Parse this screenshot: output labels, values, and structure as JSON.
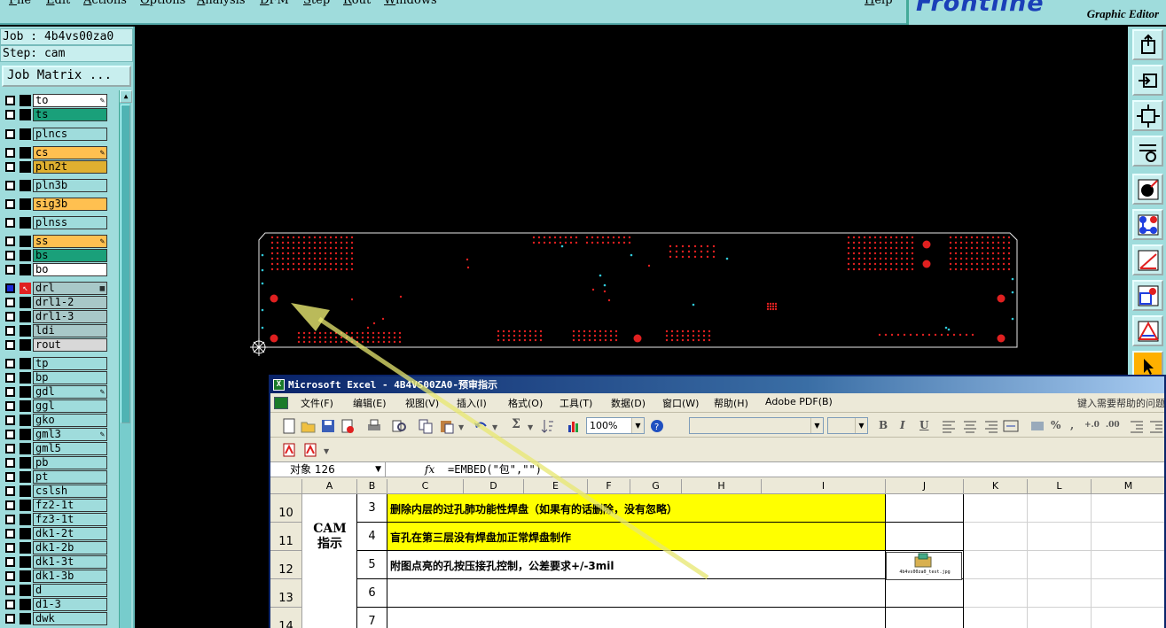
{
  "menubar": {
    "items": [
      "File",
      "Edit",
      "Actions",
      "Options",
      "Analysis",
      "DFM",
      "Step",
      "Rout",
      "Windows"
    ],
    "help": "Help"
  },
  "logo": {
    "brand_main": "Frontline",
    "subtitle": "Graphic Editor"
  },
  "left": {
    "job": "Job : 4b4vs00za0",
    "step": "Step: cam",
    "job_matrix": "Job Matrix ...",
    "layers": [
      {
        "name": "to",
        "color": "#ffffff",
        "flag": "✎"
      },
      {
        "name": "ts",
        "color": "#1aa07a",
        "flag": ""
      },
      {
        "name": "plncs",
        "color": "#9fdcdc",
        "flag": ""
      },
      {
        "name": "cs",
        "color": "#ffc050",
        "flag": "✎"
      },
      {
        "name": "pln2t",
        "color": "#e0b030",
        "flag": ""
      },
      {
        "name": "pln3b",
        "color": "#9fdcdc",
        "flag": ""
      },
      {
        "name": "sig3b",
        "color": "#ffc050",
        "flag": ""
      },
      {
        "name": "plnss",
        "color": "#9fdcdc",
        "flag": ""
      },
      {
        "name": "ss",
        "color": "#ffc050",
        "flag": "✎"
      },
      {
        "name": "bs",
        "color": "#1aa07a",
        "flag": ""
      },
      {
        "name": "bo",
        "color": "#ffffff",
        "flag": ""
      },
      {
        "name": "drl",
        "color": "#a8c8c8",
        "flag": "▦"
      },
      {
        "name": "drl1-2",
        "color": "#a8c8c8",
        "flag": ""
      },
      {
        "name": "drl1-3",
        "color": "#a8c8c8",
        "flag": ""
      },
      {
        "name": "ldi",
        "color": "#a8c8c8",
        "flag": ""
      },
      {
        "name": "rout",
        "color": "#d8d8d8",
        "flag": ""
      },
      {
        "name": "tp",
        "color": "#9fdcdc",
        "flag": ""
      },
      {
        "name": "bp",
        "color": "#9fdcdc",
        "flag": ""
      },
      {
        "name": "gdl",
        "color": "#9fdcdc",
        "flag": "✎"
      },
      {
        "name": "ggl",
        "color": "#9fdcdc",
        "flag": ""
      },
      {
        "name": "gko",
        "color": "#9fdcdc",
        "flag": ""
      },
      {
        "name": "gml3",
        "color": "#9fdcdc",
        "flag": "✎"
      },
      {
        "name": "gml5",
        "color": "#9fdcdc",
        "flag": ""
      },
      {
        "name": "pb",
        "color": "#9fdcdc",
        "flag": ""
      },
      {
        "name": "pt",
        "color": "#9fdcdc",
        "flag": ""
      },
      {
        "name": "cslsh",
        "color": "#9fdcdc",
        "flag": ""
      },
      {
        "name": "fz2-1t",
        "color": "#9fdcdc",
        "flag": ""
      },
      {
        "name": "fz3-1t",
        "color": "#9fdcdc",
        "flag": ""
      },
      {
        "name": "dk1-2t",
        "color": "#9fdcdc",
        "flag": ""
      },
      {
        "name": "dk1-2b",
        "color": "#9fdcdc",
        "flag": ""
      },
      {
        "name": "dk1-3t",
        "color": "#9fdcdc",
        "flag": ""
      },
      {
        "name": "dk1-3b",
        "color": "#9fdcdc",
        "flag": ""
      },
      {
        "name": "d",
        "color": "#9fdcdc",
        "flag": ""
      },
      {
        "name": "d1-3",
        "color": "#9fdcdc",
        "flag": ""
      },
      {
        "name": "dwk",
        "color": "#9fdcdc",
        "flag": ""
      }
    ]
  },
  "excel": {
    "title": "Microsoft Excel - 4B4VS00ZA0-预审指示",
    "menu": [
      "文件(F)",
      "编辑(E)",
      "视图(V)",
      "插入(I)",
      "格式(O)",
      "工具(T)",
      "数据(D)",
      "窗口(W)",
      "帮助(H)",
      "Adobe PDF(B)"
    ],
    "help_box": "键入需要帮助的问题",
    "zoom": "100%",
    "name_box": "对象 126",
    "fx": "fx",
    "formula": "=EMBED(\"包\",\"\")",
    "columns": [
      "A",
      "B",
      "C",
      "D",
      "E",
      "F",
      "G",
      "H",
      "I",
      "J",
      "K",
      "L",
      "M"
    ],
    "rows": [
      {
        "row": "10",
        "num": "3",
        "text": "删除内层的过孔肺功能性焊盘（如果有的话删除，没有忽略）",
        "highlight": true
      },
      {
        "row": "11",
        "num": "4",
        "text": "盲孔在第三层没有焊盘加正常焊盘制作",
        "highlight": true
      },
      {
        "row": "12",
        "num": "5",
        "text": "附图点亮的孔按压接孔控制，公差要求+/-3mil",
        "highlight": false
      },
      {
        "row": "13",
        "num": "6",
        "text": "",
        "highlight": false
      },
      {
        "row": "14",
        "num": "7",
        "text": "",
        "highlight": false
      }
    ],
    "merged_label": "CAM\n指示",
    "embedded_caption": "4b4vs00za0_test.jpg"
  }
}
